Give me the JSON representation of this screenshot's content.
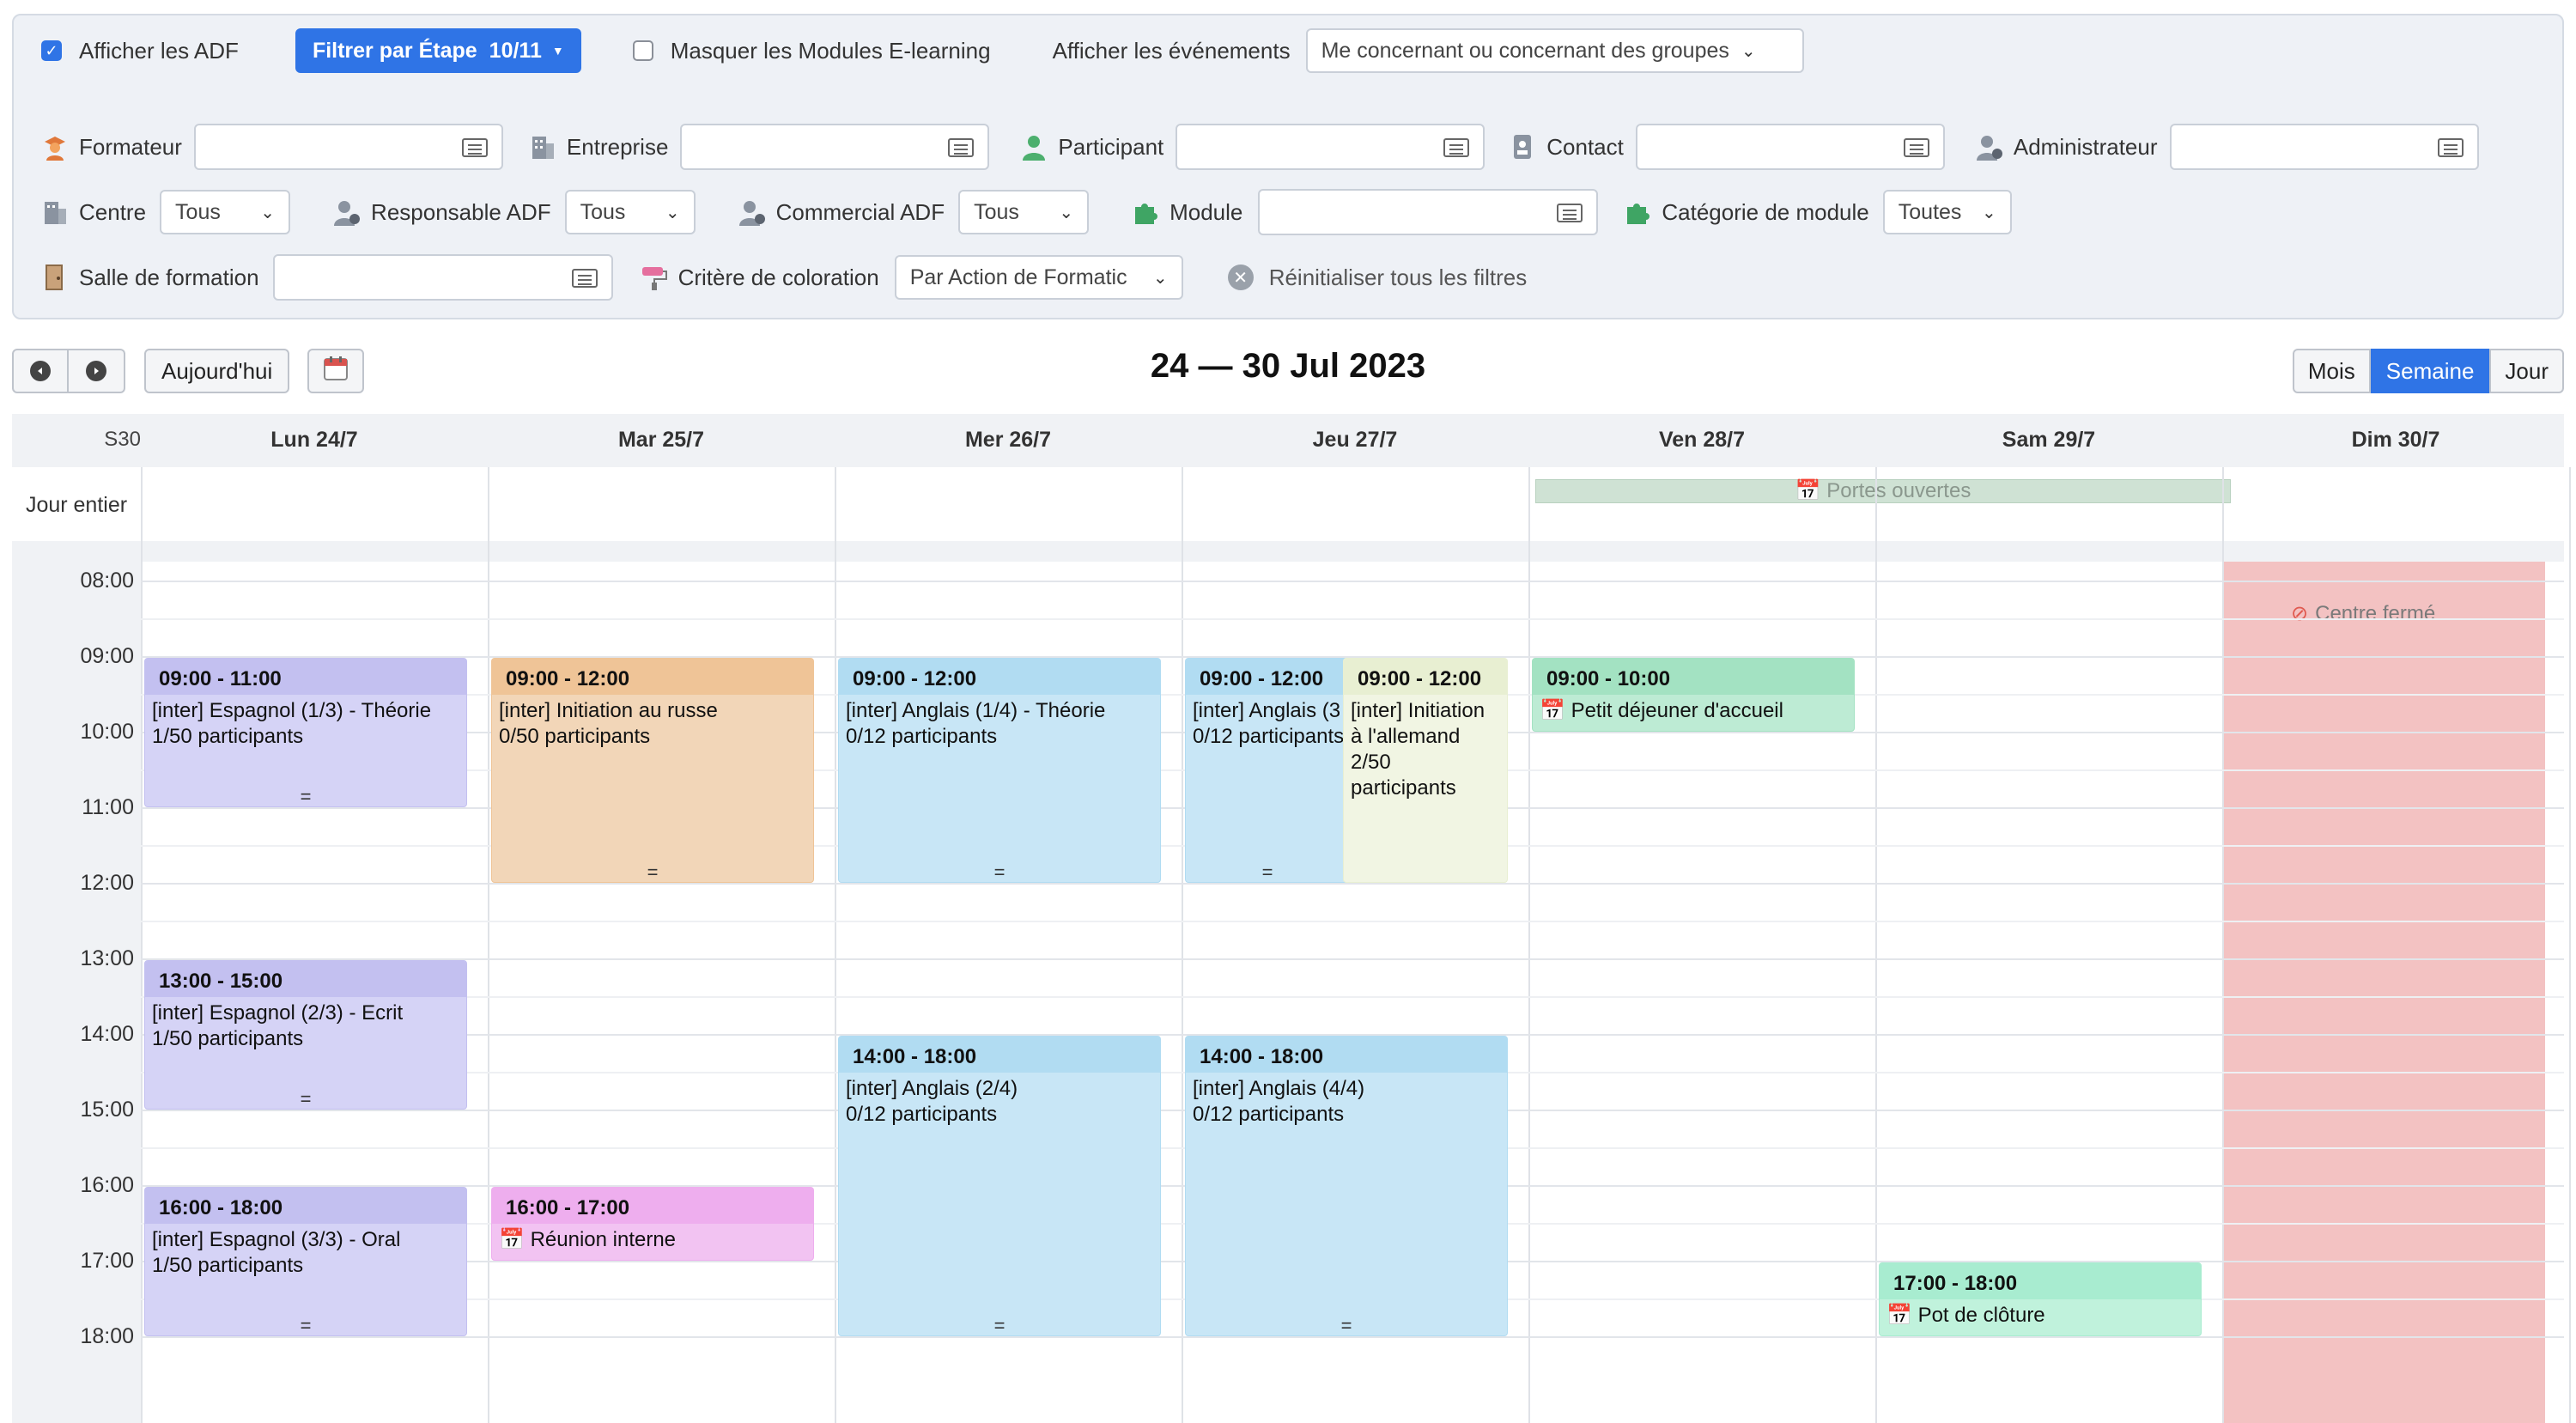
{
  "filters": {
    "show_adf": {
      "label": "Afficher les ADF",
      "checked": true
    },
    "filter_step": {
      "label": "Filtrer par Étape",
      "count": "10/11"
    },
    "hide_elearning": {
      "label": "Masquer les Modules E-learning",
      "checked": false
    },
    "show_events": {
      "label": "Afficher les événements",
      "value": "Me concernant ou concernant des groupes"
    },
    "trainer_label": "Formateur",
    "company_label": "Entreprise",
    "participant_label": "Participant",
    "contact_label": "Contact",
    "admin_label": "Administrateur",
    "center": {
      "label": "Centre",
      "value": "Tous"
    },
    "adf_manager": {
      "label": "Responsable ADF",
      "value": "Tous"
    },
    "adf_sales": {
      "label": "Commercial ADF",
      "value": "Tous"
    },
    "module_label": "Module",
    "module_category": {
      "label": "Catégorie de module",
      "value": "Toutes"
    },
    "room_label": "Salle de formation",
    "coloring": {
      "label": "Critère de coloration",
      "value": "Par Action de Formatic"
    },
    "reset_label": "Réinitialiser tous les filtres"
  },
  "toolbar": {
    "today_label": "Aujourd'hui",
    "period_title": "24 — 30 Jul 2023",
    "views": [
      {
        "label": "Mois",
        "active": false
      },
      {
        "label": "Semaine",
        "active": true
      },
      {
        "label": "Jour",
        "active": false
      }
    ]
  },
  "calendar": {
    "week_label": "S30",
    "allday_label": "Jour entier",
    "days": [
      "Lun 24/7",
      "Mar 25/7",
      "Mer 26/7",
      "Jeu 27/7",
      "Ven 28/7",
      "Sam 29/7",
      "Dim 30/7"
    ],
    "hours": [
      "08:00",
      "09:00",
      "10:00",
      "11:00",
      "12:00",
      "13:00",
      "14:00",
      "15:00",
      "16:00",
      "17:00",
      "18:00"
    ],
    "allday_event": {
      "title": "Portes ouvertes",
      "day": 4,
      "span": 2
    },
    "closed": {
      "label": "Centre fermé",
      "day": 6
    },
    "events": [
      {
        "day": 0,
        "col": 0,
        "cols": 1,
        "start": 9,
        "end": 11,
        "time": "09:00 - 11:00",
        "title": "[inter] Espagnol (1/3) - Théorie",
        "sub": "1/50 participants",
        "bg": "#d5d3f6",
        "hd": "#c3c0f0",
        "grip": true,
        "icon": false
      },
      {
        "day": 0,
        "col": 0,
        "cols": 1,
        "start": 13,
        "end": 15,
        "time": "13:00 - 15:00",
        "title": "[inter] Espagnol (2/3) - Ecrit",
        "sub": "1/50 participants",
        "bg": "#d5d3f6",
        "hd": "#c3c0f0",
        "grip": true,
        "icon": false
      },
      {
        "day": 0,
        "col": 0,
        "cols": 1,
        "start": 16,
        "end": 18,
        "time": "16:00 - 18:00",
        "title": "[inter] Espagnol (3/3) - Oral",
        "sub": "1/50 participants",
        "bg": "#d5d3f6",
        "hd": "#c3c0f0",
        "grip": true,
        "icon": false
      },
      {
        "day": 1,
        "col": 0,
        "cols": 1,
        "start": 9,
        "end": 12,
        "time": "09:00 - 12:00",
        "title": "[inter] Initiation au russe",
        "sub": "0/50 participants",
        "bg": "#f2d6b8",
        "hd": "#efc497",
        "grip": true,
        "icon": false
      },
      {
        "day": 1,
        "col": 0,
        "cols": 1,
        "start": 16,
        "end": 17,
        "time": "16:00 - 17:00",
        "title": "Réunion interne",
        "sub": "",
        "bg": "#f2c3f2",
        "hd": "#eeaeee",
        "grip": false,
        "icon": true
      },
      {
        "day": 2,
        "col": 0,
        "cols": 1,
        "start": 9,
        "end": 12,
        "time": "09:00 - 12:00",
        "title": "[inter] Anglais (1/4) - Théorie",
        "sub": "0/12 participants",
        "bg": "#c8e6f6",
        "hd": "#b1dcf2",
        "grip": true,
        "icon": false
      },
      {
        "day": 2,
        "col": 0,
        "cols": 1,
        "start": 14,
        "end": 18,
        "time": "14:00 - 18:00",
        "title": "[inter] Anglais (2/4)",
        "sub": "0/12 participants",
        "bg": "#c8e6f6",
        "hd": "#b1dcf2",
        "grip": true,
        "icon": false
      },
      {
        "day": 3,
        "col": 0,
        "cols": 2,
        "start": 9,
        "end": 12,
        "time": "09:00 - 12:00",
        "title": "[inter] Anglais (3",
        "sub": "0/12 participants",
        "bg": "#c8e6f6",
        "hd": "#b1dcf2",
        "grip": true,
        "icon": false
      },
      {
        "day": 3,
        "col": 1,
        "cols": 2,
        "start": 9,
        "end": 12,
        "time": "09:00 - 12:00",
        "title": "[inter] Initiation à l'allemand",
        "sub": "2/50 participants",
        "bg": "#f1f5e3",
        "hd": "#e8efd2",
        "grip": false,
        "icon": false
      },
      {
        "day": 3,
        "col": 0,
        "cols": 1,
        "start": 14,
        "end": 18,
        "time": "14:00 - 18:00",
        "title": "[inter] Anglais (4/4)",
        "sub": "0/12 participants",
        "bg": "#c8e6f6",
        "hd": "#b1dcf2",
        "grip": true,
        "icon": false
      },
      {
        "day": 4,
        "col": 0,
        "cols": 1,
        "start": 9,
        "end": 10,
        "time": "09:00 - 10:00",
        "title": "Petit déjeuner d'accueil",
        "sub": "",
        "bg": "#bdebd4",
        "hd": "#a3e2c2",
        "grip": false,
        "icon": true
      },
      {
        "day": 5,
        "col": 0,
        "cols": 1,
        "start": 17,
        "end": 18,
        "time": "17:00 - 18:00",
        "title": "Pot de clôture",
        "sub": "",
        "bg": "#c0f2dc",
        "hd": "#a8ecd0",
        "grip": false,
        "icon": true
      }
    ]
  }
}
